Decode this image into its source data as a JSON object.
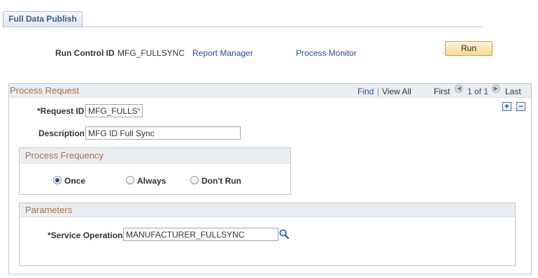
{
  "tab": {
    "label": "Full Data Publish"
  },
  "run_control": {
    "label": "Run Control ID",
    "value": "MFG_FULLSYNC",
    "report_manager": "Report Manager",
    "process_monitor": "Process Monitor",
    "run_button": "Run"
  },
  "process_request": {
    "title": "Process Request",
    "nav": {
      "find": "Find",
      "separator": "|",
      "view_all": "View All",
      "first": "First",
      "range": "1 of 1",
      "last": "Last"
    },
    "add_symbol": "+",
    "delete_symbol": "−",
    "request_id_label": "*Request ID",
    "request_id_value": "MFG_FULLSY",
    "description_label": "Description",
    "description_value": "MFG ID Full Sync"
  },
  "frequency": {
    "title": "Process Frequency",
    "options": [
      {
        "label": "Once",
        "selected": true
      },
      {
        "label": "Always",
        "selected": false
      },
      {
        "label": "Don't Run",
        "selected": false
      }
    ]
  },
  "parameters": {
    "title": "Parameters",
    "service_operation_label": "*Service Operation",
    "service_operation_value": "MANUFACTURER_FULLSYNC"
  },
  "icons": {
    "nav_prev": "arrow-left-icon",
    "nav_next": "arrow-right-icon",
    "lookup": "magnifier-icon"
  },
  "colors": {
    "section_title": "#b06e3a",
    "link": "#1f4e91",
    "header_bg": "#eaeef3",
    "run_button": "#f8d98f"
  }
}
